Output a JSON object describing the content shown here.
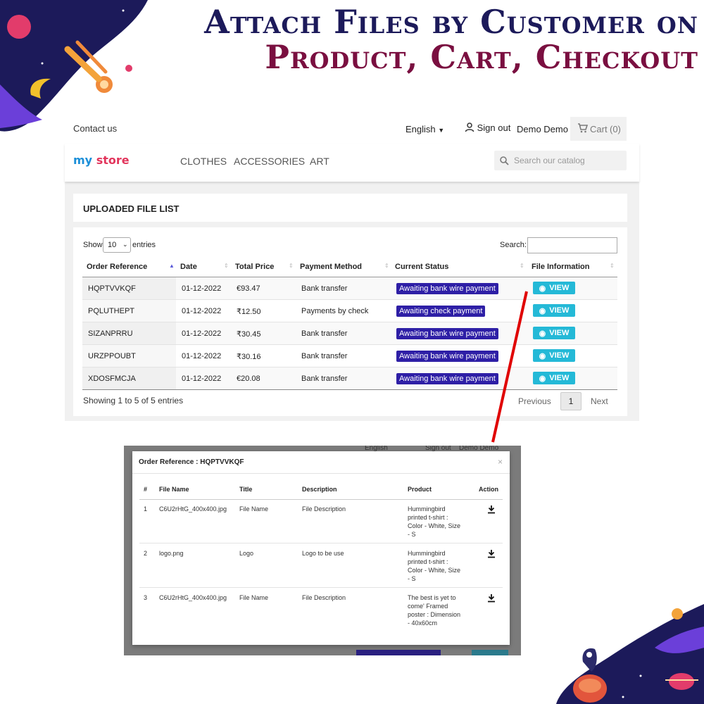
{
  "headline": {
    "line1": "Attach Files by Customer on",
    "line2": "Product, Cart, Checkout"
  },
  "topbar": {
    "contact": "Contact us",
    "language": "English",
    "sign_out": "Sign out",
    "user": "Demo Demo",
    "cart": "Cart",
    "cart_count": "(0)"
  },
  "nav": {
    "logo_my": "my",
    "logo_store": "store",
    "items": [
      "CLOTHES",
      "ACCESSORIES",
      "ART"
    ],
    "search_placeholder": "Search our catalog"
  },
  "page": {
    "title": "UPLOADED FILE LIST",
    "show_label": "Show",
    "entries_value": "10",
    "entries_label": "entries",
    "search_label": "Search:",
    "columns": [
      "Order Reference",
      "Date",
      "Total Price",
      "Payment Method",
      "Current Status",
      "File Information"
    ],
    "rows": [
      {
        "ref": "HQPTVVKQF",
        "date": "01-12-2022",
        "price": "€93.47",
        "method": "Bank transfer",
        "status": "Awaiting bank wire payment",
        "action": "VIEW"
      },
      {
        "ref": "PQLUTHEPT",
        "date": "01-12-2022",
        "price": "₹12.50",
        "method": "Payments by check",
        "status": "Awaiting check payment",
        "action": "VIEW"
      },
      {
        "ref": "SIZANPRRU",
        "date": "01-12-2022",
        "price": "₹30.45",
        "method": "Bank transfer",
        "status": "Awaiting bank wire payment",
        "action": "VIEW"
      },
      {
        "ref": "URZPPOUBT",
        "date": "01-12-2022",
        "price": "₹30.16",
        "method": "Bank transfer",
        "status": "Awaiting bank wire payment",
        "action": "VIEW"
      },
      {
        "ref": "XDOSFMCJA",
        "date": "01-12-2022",
        "price": "€20.08",
        "method": "Bank transfer",
        "status": "Awaiting bank wire payment",
        "action": "VIEW"
      }
    ],
    "summary": "Showing 1 to 5 of 5 entries",
    "previous": "Previous",
    "page_number": "1",
    "next": "Next"
  },
  "modal": {
    "bg_language": "English",
    "bg_sign_out": "Sign out",
    "bg_user": "Demo Demo",
    "title": "Order Reference : HQPTVVKQF",
    "close": "×",
    "columns": [
      "#",
      "File Name",
      "Title",
      "Description",
      "Product",
      "Action"
    ],
    "rows": [
      {
        "num": "1",
        "file": "C6U2rHtG_400x400.jpg",
        "title": "File Name",
        "desc": "File Description",
        "product": [
          "Hummingbird",
          "printed t-shirt :",
          "Color - White, Size",
          "- S"
        ]
      },
      {
        "num": "2",
        "file": "logo.png",
        "title": "Logo",
        "desc": "Logo to be use",
        "product": [
          "Hummingbird",
          "printed t-shirt :",
          "Color - White, Size",
          "- S"
        ]
      },
      {
        "num": "3",
        "file": "C6U2rHtG_400x400.jpg",
        "title": "File Name",
        "desc": "File Description",
        "product": [
          "The best is yet to",
          "come' Framed",
          "poster : Dimension",
          "- 40x60cm"
        ]
      }
    ]
  },
  "colors": {
    "headline_navy": "#1c1a5a",
    "headline_maroon": "#7a0f40",
    "status_badge": "#2e1fa6",
    "view_button": "#24b9d7",
    "arrow": "#e00000"
  }
}
